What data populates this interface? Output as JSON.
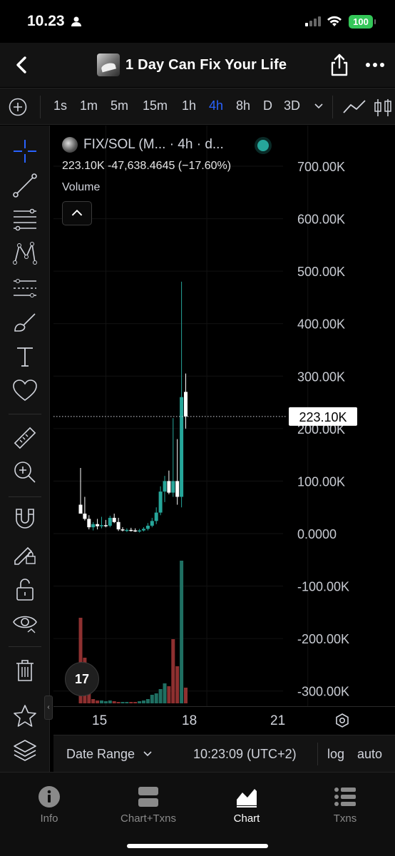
{
  "status_bar": {
    "time": "10.23",
    "battery": "100"
  },
  "header": {
    "title": "1 Day Can Fix Your Life"
  },
  "timeframes": {
    "items": [
      {
        "label": "1s",
        "active": false
      },
      {
        "label": "1m",
        "active": false
      },
      {
        "label": "5m",
        "active": false
      },
      {
        "label": "15m",
        "active": false
      },
      {
        "label": "1h",
        "active": false
      },
      {
        "label": "4h",
        "active": true
      },
      {
        "label": "8h",
        "active": false
      },
      {
        "label": "D",
        "active": false
      },
      {
        "label": "3D",
        "active": false
      }
    ]
  },
  "legend": {
    "symbol": "FIX/SOL (M... · 4h · d...",
    "ohlc_line": "223.10K  -47,638.4645 (−17.60%)",
    "volume_label": "Volume",
    "tv_logo": "17"
  },
  "colors": {
    "up": "#26a69a",
    "down": "#ef5350",
    "up_volume": "#1f6f62",
    "down_volume": "#8e3030",
    "accent": "#2962ff",
    "background": "#000000"
  },
  "chart_data": {
    "type": "candlestick",
    "y_axis": {
      "ticks": [
        "700.00K",
        "600.00K",
        "500.00K",
        "400.00K",
        "300.00K",
        "200.00K",
        "100.00K",
        "0.0000",
        "-100.00K",
        "-200.00K",
        "-300.00K"
      ],
      "tick_values": [
        700000,
        600000,
        500000,
        400000,
        300000,
        200000,
        100000,
        0,
        -100000,
        -200000,
        -300000
      ],
      "range": [
        -320000,
        750000
      ]
    },
    "x_axis": {
      "ticks": [
        "15",
        "18",
        "21"
      ],
      "tick_index": [
        5,
        29,
        53
      ]
    },
    "last_price": {
      "label": "223.10K",
      "value": 223100
    },
    "candles": [
      {
        "i": 0,
        "o": 55000,
        "h": 125000,
        "l": 40000,
        "c": 38000
      },
      {
        "i": 1,
        "o": 38000,
        "h": 70000,
        "l": 25000,
        "c": 28000
      },
      {
        "i": 2,
        "o": 28000,
        "h": 35000,
        "l": 8000,
        "c": 12000
      },
      {
        "i": 3,
        "o": 12000,
        "h": 22000,
        "l": 6000,
        "c": 18000
      },
      {
        "i": 4,
        "o": 18000,
        "h": 28000,
        "l": 8000,
        "c": 14000
      },
      {
        "i": 5,
        "o": 14000,
        "h": 32000,
        "l": 10000,
        "c": 16000
      },
      {
        "i": 6,
        "o": 16000,
        "h": 26000,
        "l": 12000,
        "c": 15000
      },
      {
        "i": 7,
        "o": 15000,
        "h": 34000,
        "l": 12000,
        "c": 30000
      },
      {
        "i": 8,
        "o": 30000,
        "h": 38000,
        "l": 20000,
        "c": 22000
      },
      {
        "i": 9,
        "o": 22000,
        "h": 30000,
        "l": 5000,
        "c": 8000
      },
      {
        "i": 10,
        "o": 8000,
        "h": 12000,
        "l": 4000,
        "c": 6000
      },
      {
        "i": 11,
        "o": 6000,
        "h": 10000,
        "l": 3000,
        "c": 7000
      },
      {
        "i": 12,
        "o": 7000,
        "h": 11000,
        "l": 4000,
        "c": 6000
      },
      {
        "i": 13,
        "o": 6000,
        "h": 10000,
        "l": 3000,
        "c": 5000
      },
      {
        "i": 14,
        "o": 5000,
        "h": 9000,
        "l": 2000,
        "c": 6000
      },
      {
        "i": 15,
        "o": 6000,
        "h": 12000,
        "l": 4000,
        "c": 9000
      },
      {
        "i": 16,
        "o": 9000,
        "h": 20000,
        "l": 6000,
        "c": 15000
      },
      {
        "i": 17,
        "o": 15000,
        "h": 30000,
        "l": 12000,
        "c": 24000
      },
      {
        "i": 18,
        "o": 24000,
        "h": 50000,
        "l": 18000,
        "c": 40000
      },
      {
        "i": 19,
        "o": 40000,
        "h": 90000,
        "l": 35000,
        "c": 80000
      },
      {
        "i": 20,
        "o": 80000,
        "h": 110000,
        "l": 60000,
        "c": 100000
      },
      {
        "i": 21,
        "o": 100000,
        "h": 120000,
        "l": 75000,
        "c": 78000
      },
      {
        "i": 22,
        "o": 78000,
        "h": 220000,
        "l": 70000,
        "c": 100000
      },
      {
        "i": 23,
        "o": 100000,
        "h": 180000,
        "l": 55000,
        "c": 70000
      },
      {
        "i": 24,
        "o": 70000,
        "h": 480000,
        "l": 50000,
        "c": 260000
      },
      {
        "i": 25,
        "o": 270000,
        "h": 305000,
        "l": 200000,
        "c": 223100
      }
    ],
    "volume": [
      {
        "i": 0,
        "v": 0.6,
        "up": false
      },
      {
        "i": 1,
        "v": 0.32,
        "up": false
      },
      {
        "i": 2,
        "v": 0.12,
        "up": false
      },
      {
        "i": 3,
        "v": 0.03,
        "up": false
      },
      {
        "i": 4,
        "v": 0.02,
        "up": false
      },
      {
        "i": 5,
        "v": 0.02,
        "up": true
      },
      {
        "i": 6,
        "v": 0.015,
        "up": true
      },
      {
        "i": 7,
        "v": 0.02,
        "up": true
      },
      {
        "i": 8,
        "v": 0.015,
        "up": false
      },
      {
        "i": 9,
        "v": 0.01,
        "up": false
      },
      {
        "i": 10,
        "v": 0.01,
        "up": true
      },
      {
        "i": 11,
        "v": 0.008,
        "up": true
      },
      {
        "i": 12,
        "v": 0.01,
        "up": false
      },
      {
        "i": 13,
        "v": 0.01,
        "up": false
      },
      {
        "i": 14,
        "v": 0.015,
        "up": true
      },
      {
        "i": 15,
        "v": 0.02,
        "up": true
      },
      {
        "i": 16,
        "v": 0.03,
        "up": true
      },
      {
        "i": 17,
        "v": 0.06,
        "up": true
      },
      {
        "i": 18,
        "v": 0.07,
        "up": true
      },
      {
        "i": 19,
        "v": 0.1,
        "up": true
      },
      {
        "i": 20,
        "v": 0.14,
        "up": true
      },
      {
        "i": 21,
        "v": 0.12,
        "up": false
      },
      {
        "i": 22,
        "v": 0.45,
        "up": false
      },
      {
        "i": 23,
        "v": 0.26,
        "up": false
      },
      {
        "i": 24,
        "v": 1.0,
        "up": true
      },
      {
        "i": 25,
        "v": 0.11,
        "up": false
      }
    ]
  },
  "bottom_bar": {
    "date_range": "Date Range",
    "clock": "10:23:09 (UTC+2)",
    "log": "log",
    "auto": "auto"
  },
  "tabs": [
    {
      "label": "Info",
      "active": false
    },
    {
      "label": "Chart+Txns",
      "active": false
    },
    {
      "label": "Chart",
      "active": true
    },
    {
      "label": "Txns",
      "active": false
    }
  ]
}
